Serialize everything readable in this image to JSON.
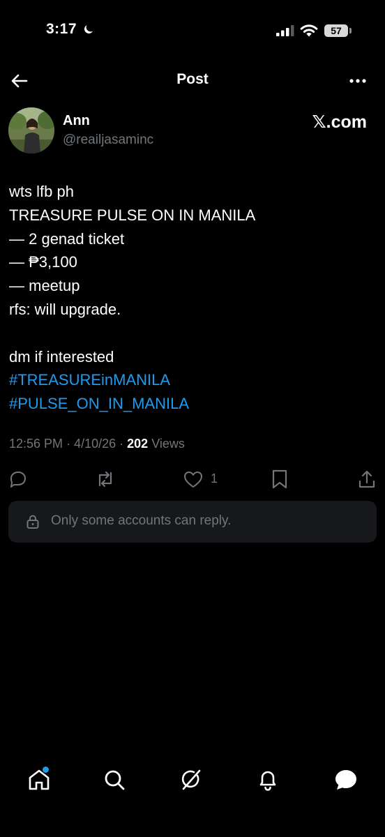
{
  "status_bar": {
    "time": "3:17",
    "battery_level": "57",
    "icons": [
      "moon-icon",
      "signal-icon",
      "wifi-icon",
      "battery-icon"
    ]
  },
  "header": {
    "title": "Post",
    "back_icon": "arrow-left-icon",
    "more_icon": "more-horizontal-icon"
  },
  "author": {
    "name": "Ann",
    "handle": "@reailjasaminc",
    "source": "𝕏.com"
  },
  "post": {
    "lines": [
      {
        "text": "wts lfb ph",
        "type": "text"
      },
      {
        "text": "TREASURE PULSE ON IN MANILA",
        "type": "text"
      },
      {
        "text": "— 2 genad ticket",
        "type": "text"
      },
      {
        "text": "— ₱3,100",
        "type": "text"
      },
      {
        "text": "— meetup",
        "type": "text"
      },
      {
        "text": "rfs: will upgrade.",
        "type": "text"
      },
      {
        "text": "",
        "type": "text"
      },
      {
        "text": "dm if interested",
        "type": "text"
      },
      {
        "text": "#TREASUREinMANILA",
        "type": "hashtag"
      },
      {
        "text": "#PULSE_ON_IN_MANILA",
        "type": "hashtag"
      }
    ],
    "meta": {
      "time": "12:56 PM",
      "date": "4/10/26",
      "views_count": "202",
      "views_label": "Views"
    }
  },
  "actions": {
    "reply_icon": "reply-icon",
    "repost_icon": "repost-icon",
    "like_icon": "heart-icon",
    "like_count": "1",
    "bookmark_icon": "bookmark-icon",
    "share_icon": "share-icon"
  },
  "reply_restriction": {
    "text": "Only some accounts can reply."
  },
  "bottom_nav": {
    "items": [
      "home-icon",
      "search-icon",
      "grok-icon",
      "notifications-icon",
      "messages-icon"
    ],
    "accent": "#1d9bf0"
  }
}
